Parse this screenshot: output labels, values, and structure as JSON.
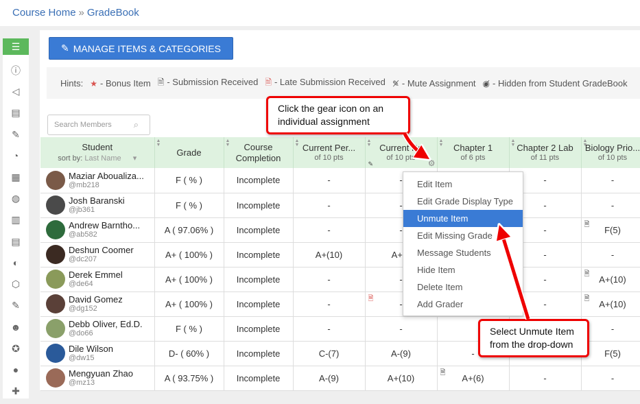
{
  "breadcrumb": {
    "home": "Course Home",
    "separator": "»",
    "current": "GradeBook"
  },
  "sidebar_icons": [
    "gradebook-icon",
    "info-icon",
    "announcement-icon",
    "content-icon",
    "assignment-icon",
    "reports-icon",
    "calendar-icon",
    "globe-icon",
    "library-icon",
    "notes-icon",
    "lightbulb-icon",
    "package-icon",
    "gradebook-edit-icon",
    "members-icon",
    "badge-icon",
    "user-icon",
    "add-icon"
  ],
  "toolbar": {
    "manage_label": "MANAGE ITEMS & CATEGORIES"
  },
  "hints": {
    "label": "Hints:",
    "bonus": "- Bonus Item",
    "submission": "- Submission Received",
    "late": "- Late Submission Received",
    "mute": "- Mute Assignment",
    "hidden": "- Hidden from Student GradeBook"
  },
  "search": {
    "placeholder": "Search Members"
  },
  "columns": [
    {
      "title": "Student",
      "sub": ""
    },
    {
      "title": "Grade",
      "sub": ""
    },
    {
      "title": "Course Completion",
      "sub": ""
    },
    {
      "title": "Current Per...",
      "sub": "of 10 pts"
    },
    {
      "title": "Current Pe",
      "sub": "of 10 pts"
    },
    {
      "title": "Chapter 1",
      "sub": "of 6 pts"
    },
    {
      "title": "Chapter 2 Lab",
      "sub": "of 11 pts"
    },
    {
      "title": "Biology Prio...",
      "sub": "of 10 pts"
    }
  ],
  "sort": {
    "label": "sort by:",
    "value": "Last Name"
  },
  "rows": [
    {
      "name": "Maziar Aboualiza...",
      "user": "@mb218",
      "grade": "F ( % )",
      "completion": "Incomplete",
      "c1": "-",
      "c2": "-",
      "c3": "",
      "c4": "-",
      "c5": "-",
      "color": "#7a5a48"
    },
    {
      "name": "Josh Baranski",
      "user": "@jb361",
      "grade": "F ( % )",
      "completion": "Incomplete",
      "c1": "-",
      "c2": "-",
      "c3": "",
      "c4": "-",
      "c5": "-",
      "color": "#4a4a4a"
    },
    {
      "name": "Andrew Barntho...",
      "user": "@ab582",
      "grade": "A ( 97.06% )",
      "completion": "Incomplete",
      "c1": "-",
      "c2": "-",
      "c3": "",
      "c4": "-",
      "c5": "F(5)",
      "color": "#2e6b3c"
    },
    {
      "name": "Deshun Coomer",
      "user": "@dc207",
      "grade": "A+ ( 100% )",
      "completion": "Incomplete",
      "c1": "A+(10)",
      "c2": "A+(1",
      "c3": "",
      "c4": "-",
      "c5": "-",
      "color": "#3b2a22"
    },
    {
      "name": "Derek Emmel",
      "user": "@de64",
      "grade": "A+ ( 100% )",
      "completion": "Incomplete",
      "c1": "-",
      "c2": "-",
      "c3": "",
      "c4": "-",
      "c5": "A+(10)",
      "color": "#8a9a5a"
    },
    {
      "name": "David Gomez",
      "user": "@dg152",
      "grade": "A+ ( 100% )",
      "completion": "Incomplete",
      "c1": "-",
      "c2": "-",
      "c3": "",
      "c4": "-",
      "c5": "A+(10)",
      "color": "#5a4038"
    },
    {
      "name": "Debb Oliver, Ed.D.",
      "user": "@do66",
      "grade": "F ( % )",
      "completion": "Incomplete",
      "c1": "-",
      "c2": "-",
      "c3": "",
      "c4": "-",
      "c5": "-",
      "color": "#8aa06a"
    },
    {
      "name": "Dile Wilson",
      "user": "@dw15",
      "grade": "D- ( 60% )",
      "completion": "Incomplete",
      "c1": "C-(7)",
      "c2": "A-(9)",
      "c3": "-",
      "c4": "-",
      "c5": "F(5)",
      "color": "#2a5a9a"
    },
    {
      "name": "Mengyuan Zhao",
      "user": "@mz13",
      "grade": "A ( 93.75% )",
      "completion": "Incomplete",
      "c1": "A-(9)",
      "c2": "A+(10)",
      "c3": "A+(6)",
      "c4": "-",
      "c5": "-",
      "color": "#9a6a58"
    }
  ],
  "menu": [
    "Edit Item",
    "Edit Grade Display Type",
    "Unmute Item",
    "Edit Missing Grade",
    "Message Students",
    "Hide Item",
    "Delete Item",
    "Add Grader"
  ],
  "callouts": {
    "top": "Click the gear icon on an individual assignment",
    "bottom": "Select Unmute Item from the drop-down"
  },
  "colors": {
    "accent": "#3a7bd5",
    "header_bg": "#dff2e0",
    "callout_border": "#ee0000",
    "sidebar_active": "#5cb85c"
  }
}
